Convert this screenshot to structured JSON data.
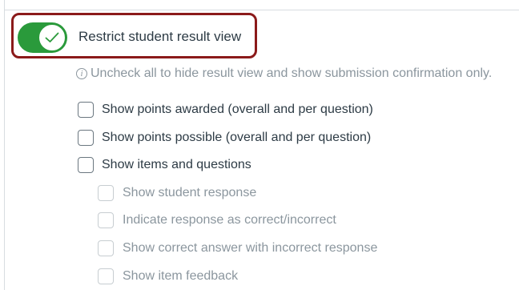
{
  "restrict_toggle": {
    "label": "Restrict student result view",
    "on": true
  },
  "info_text": "Uncheck all to hide result view and show submission confirmation only.",
  "options": [
    {
      "label": "Show points awarded (overall and per question)",
      "checked": false,
      "enabled": true
    },
    {
      "label": "Show points possible (overall and per question)",
      "checked": false,
      "enabled": true
    },
    {
      "label": "Show items and questions",
      "checked": false,
      "enabled": true
    }
  ],
  "sub_options": [
    {
      "label": "Show student response",
      "checked": false,
      "enabled": false
    },
    {
      "label": "Indicate response as correct/incorrect",
      "checked": false,
      "enabled": false
    },
    {
      "label": "Show correct answer with incorrect response",
      "checked": false,
      "enabled": false
    },
    {
      "label": "Show item feedback",
      "checked": false,
      "enabled": false
    }
  ],
  "colors": {
    "toggle_on": "#2a9a3b",
    "highlight": "#8b1a1a",
    "text": "#2d3b45",
    "muted": "#8b969e"
  }
}
